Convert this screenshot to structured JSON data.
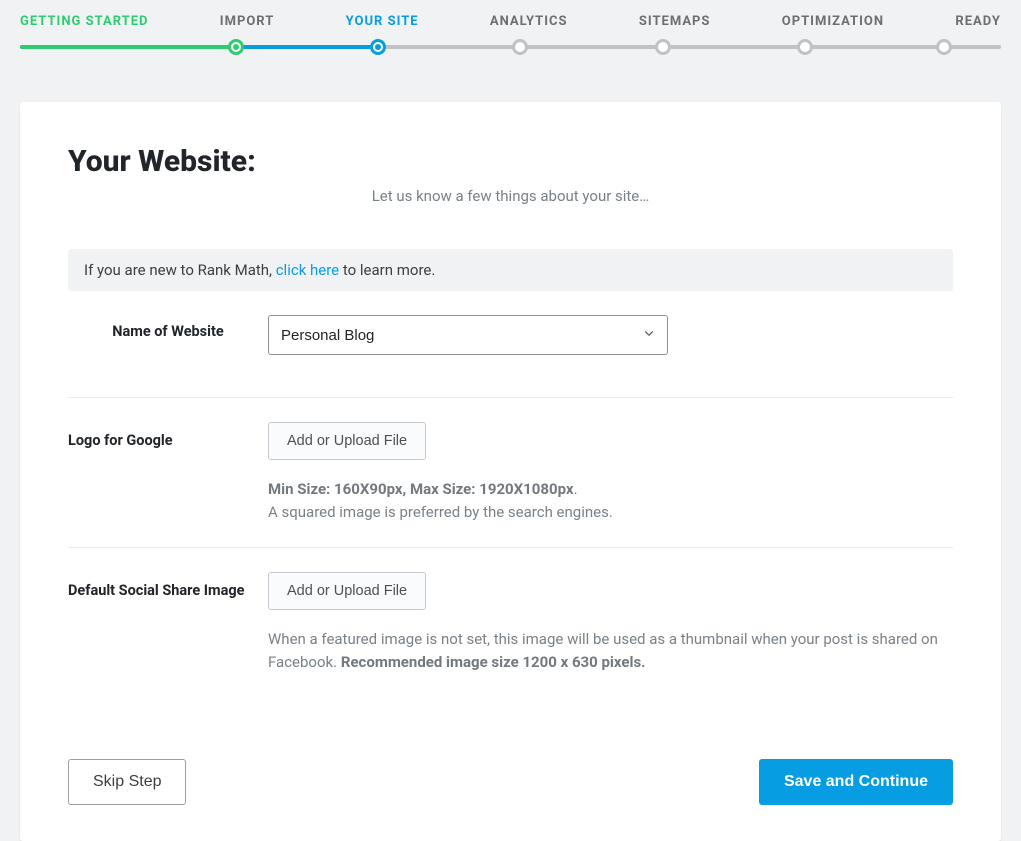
{
  "stepper": {
    "steps": [
      {
        "label": "GETTING STARTED",
        "state": "completed"
      },
      {
        "label": "IMPORT",
        "state": "completed-dot"
      },
      {
        "label": "YOUR SITE",
        "state": "active"
      },
      {
        "label": "ANALYTICS",
        "state": "future"
      },
      {
        "label": "SITEMAPS",
        "state": "future"
      },
      {
        "label": "OPTIMIZATION",
        "state": "future"
      },
      {
        "label": "READY",
        "state": "future"
      }
    ]
  },
  "header": {
    "title": "Your Website:",
    "subtitle": "Let us know a few things about your site…"
  },
  "banner": {
    "prefix": "If you are new to Rank Math, ",
    "link": "click here",
    "suffix": " to learn more."
  },
  "fields": {
    "site_name": {
      "label": "Name of Website",
      "value": "Personal Blog"
    },
    "logo": {
      "label": "Logo for Google",
      "button": "Add or Upload File",
      "help_strong": "Min Size: 160X90px, Max Size: 1920X1080px",
      "help_rest": "A squared image is preferred by the search engines."
    },
    "social": {
      "label": "Default Social Share Image",
      "button": "Add or Upload File",
      "help_plain": "When a featured image is not set, this image will be used as a thumbnail when your post is shared on Facebook. ",
      "help_strong": "Recommended image size 1200 x 630 pixels."
    }
  },
  "footer": {
    "skip": "Skip Step",
    "continue": "Save and Continue"
  }
}
